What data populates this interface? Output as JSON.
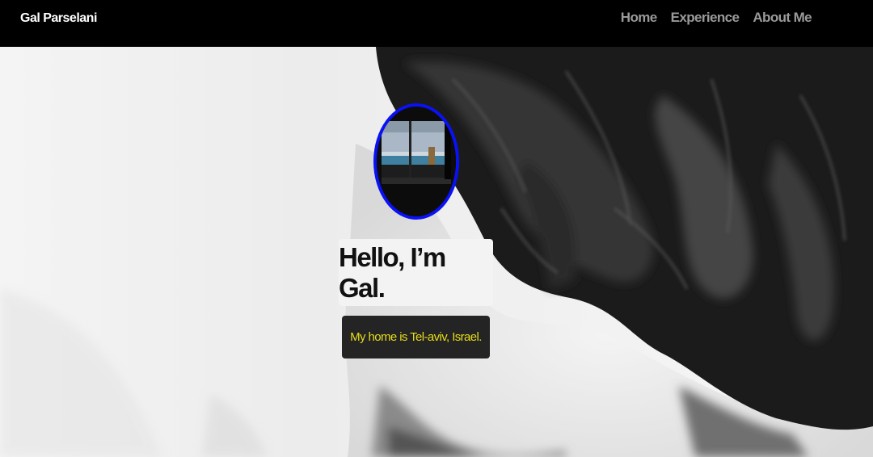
{
  "navbar": {
    "brand": "Gal Parselani",
    "links": [
      "Home",
      "Experience",
      "About Me"
    ]
  },
  "hero": {
    "greeting": "Hello, I’m Gal.",
    "home_text": "My home is Tel-aviv, Israel."
  },
  "colors": {
    "navbar_bg": "#000000",
    "nav_link": "#9a9a9a",
    "avatar_border": "#0a12f5",
    "greeting_bg": "#f3f3f3",
    "home_badge_bg": "#242424",
    "home_badge_text": "#e6dc1a"
  },
  "icons": {
    "hero_background": "grayscale-portrait-photo",
    "avatar": "window-sea-view-photo"
  }
}
